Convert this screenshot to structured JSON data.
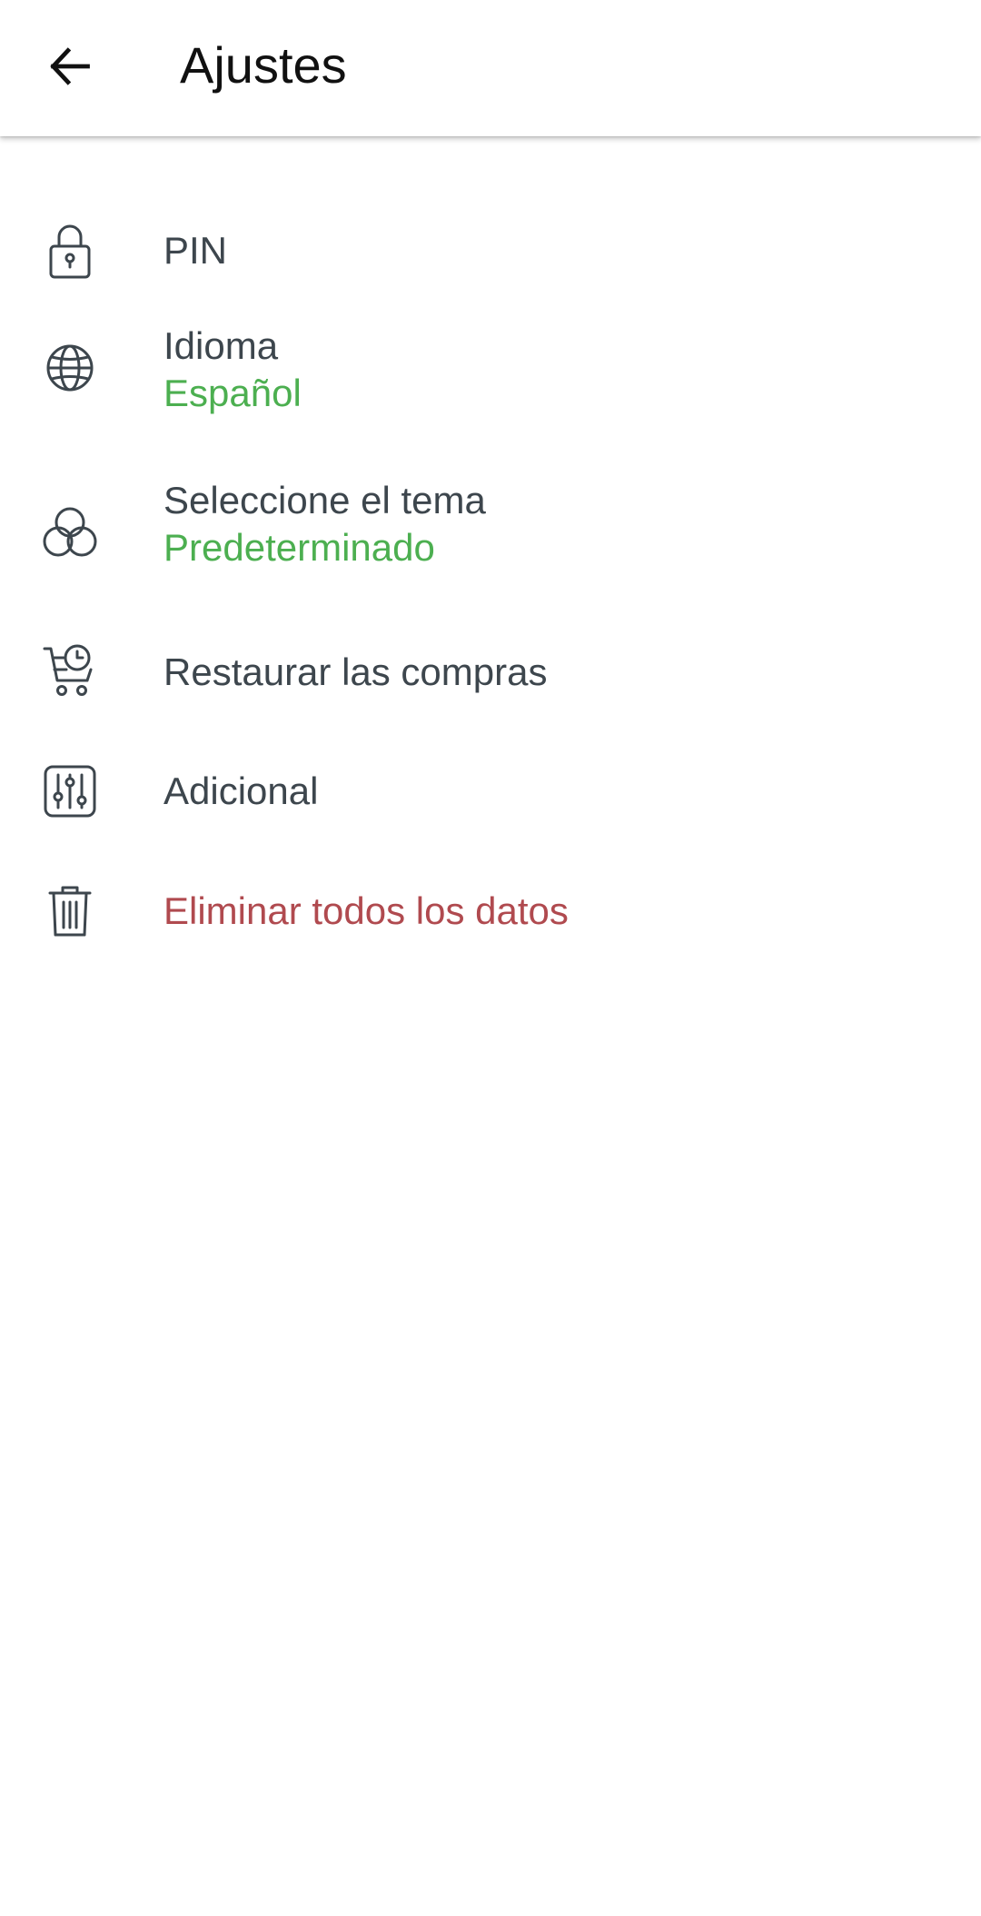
{
  "header": {
    "title": "Ajustes",
    "back_icon": "arrow-left-icon"
  },
  "settings": {
    "items": [
      {
        "icon": "lock-icon",
        "title": "PIN"
      },
      {
        "icon": "globe-icon",
        "title": "Idioma",
        "value": "Español"
      },
      {
        "icon": "theme-circles-icon",
        "title": "Seleccione el tema",
        "value": "Predeterminado"
      },
      {
        "icon": "cart-clock-icon",
        "title": "Restaurar las compras"
      },
      {
        "icon": "sliders-icon",
        "title": "Adicional"
      },
      {
        "icon": "trash-icon",
        "title": "Eliminar todos los datos"
      }
    ]
  },
  "colors": {
    "text": "#3d464d",
    "accent_value": "#4caf50",
    "danger": "#b04a4f",
    "background": "#ffffff"
  }
}
